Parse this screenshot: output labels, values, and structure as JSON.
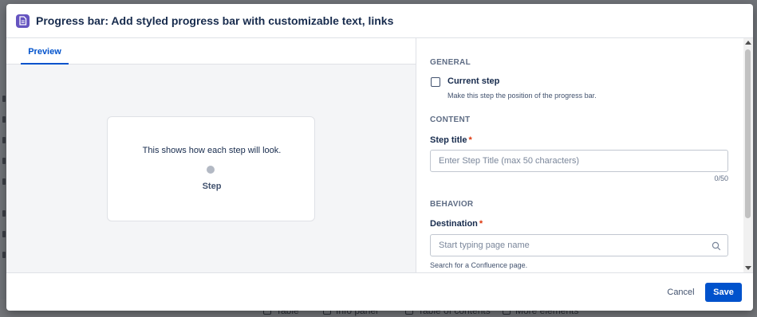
{
  "background": {
    "toolbar_items": [
      "Table",
      "Info panel",
      "Table of contents",
      "More elements"
    ]
  },
  "modal": {
    "title": "Progress bar: Add styled progress bar with customizable text, links",
    "icon": "document-icon"
  },
  "preview": {
    "tab_label": "Preview",
    "card_text": "This shows how each step will look.",
    "step_label": "Step"
  },
  "config": {
    "general": {
      "heading": "GENERAL",
      "current_step_label": "Current step",
      "current_step_checked": false,
      "current_step_help": "Make this step the position of the progress bar."
    },
    "content": {
      "heading": "CONTENT",
      "step_title_label": "Step title",
      "required_marker": "*",
      "step_title_value": "",
      "step_title_placeholder": "Enter Step Title (max 50 characters)",
      "counter": "0/50"
    },
    "behavior": {
      "heading": "BEHAVIOR",
      "destination_label": "Destination",
      "required_marker": "*",
      "destination_value": "",
      "destination_placeholder": "Start typing page name",
      "destination_help": "Search for a Confluence page."
    }
  },
  "footer": {
    "cancel_label": "Cancel",
    "save_label": "Save"
  },
  "colors": {
    "primary": "#0052cc",
    "title_icon": "#6554c0",
    "required": "#de350b"
  }
}
